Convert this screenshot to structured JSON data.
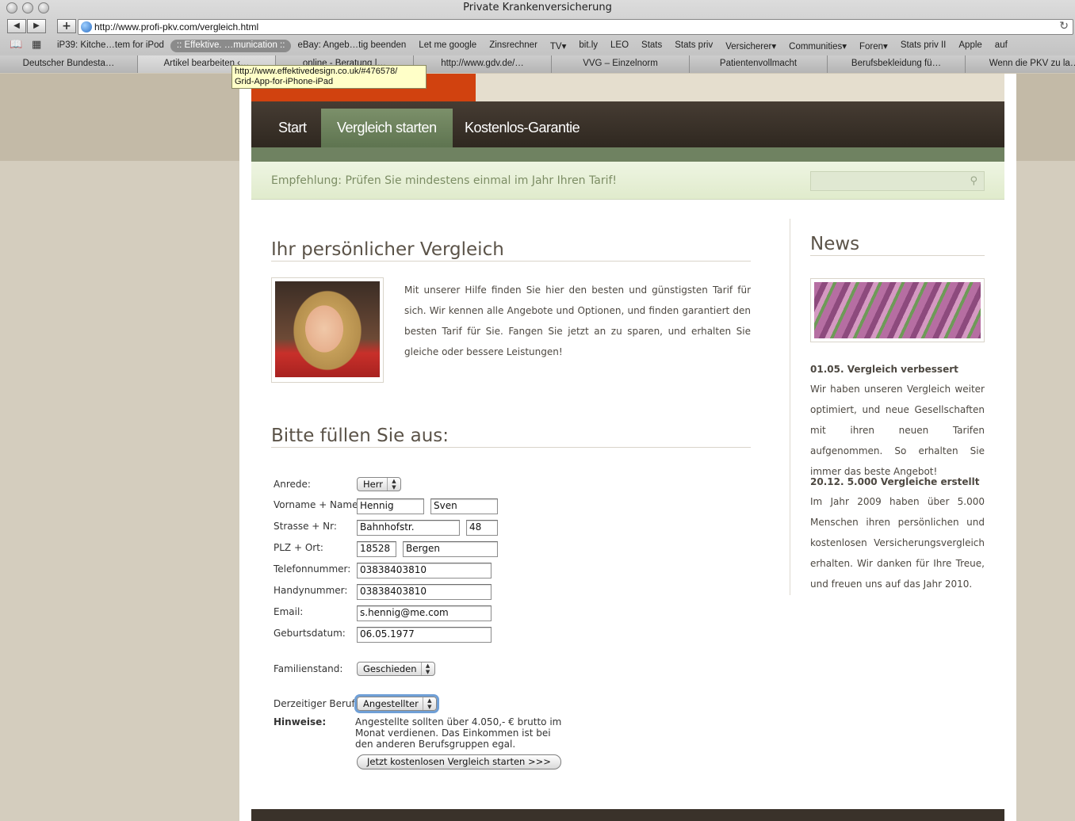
{
  "window": {
    "title": "Private Krankenversicherung"
  },
  "toolbar": {
    "back": "◀",
    "forward": "▶",
    "add": "+",
    "url": "http://www.profi-pkv.com/vergleich.html",
    "reload": "↻"
  },
  "bookmarks": {
    "items": [
      "iP39: Kitche…tem for iPod",
      ":: Effektive. …munication ::",
      "eBay: Angeb…tig beenden",
      "Let me google",
      "Zinsrechner",
      "TV▾",
      "bit.ly",
      "LEO",
      "Stats",
      "Stats priv",
      "Versicherer▾",
      "Communities▾",
      "Foren▾",
      "Stats priv II",
      "Apple",
      "auf"
    ]
  },
  "tabs": [
    "Deutscher Bundesta…",
    "Artikel bearbeiten ‹…",
    "online - Beratung |…",
    "http://www.gdv.de/…",
    "VVG – Einzelnorm",
    "Patientenvollmacht",
    "Berufsbekleidung fü…",
    "Wenn die PKV zu la…"
  ],
  "tooltip": {
    "line1": "http://www.effektivedesign.co.uk/#476578/",
    "line2": "Grid-App-for-iPhone-iPad"
  },
  "nav": {
    "start": "Start",
    "vergleich": "Vergleich starten",
    "garantie": "Kostenlos-Garantie"
  },
  "tipbar": {
    "text": "Empfehlung: Prüfen Sie mindestens einmal im Jahr Ihren Tarif!",
    "search_icon": "⚲"
  },
  "main": {
    "title": "Ihr persönlicher Vergleich",
    "intro": "Mit unserer Hilfe finden Sie hier den besten und günstigsten Tarif für sich. Wir kennen alle Angebote und Optionen, und finden garantiert den besten Tarif für Sie. Fangen Sie jetzt an zu sparen, und erhalten Sie gleiche oder bessere Leistungen!",
    "form_title": "Bitte füllen Sie aus:"
  },
  "form": {
    "anrede": {
      "label": "Anrede:",
      "value": "Herr"
    },
    "name": {
      "label": "Vorname + Name:",
      "first": "Hennig",
      "last": "Sven"
    },
    "strasse": {
      "label": "Strasse + Nr:",
      "street": "Bahnhofstr.",
      "number": "48"
    },
    "plz": {
      "label": "PLZ + Ort:",
      "zip": "18528",
      "city": "Bergen"
    },
    "telefon": {
      "label": "Telefonnummer:",
      "value": "03838403810"
    },
    "handy": {
      "label": "Handynummer:",
      "value": "03838403810"
    },
    "email": {
      "label": "Email:",
      "value": "s.hennig@me.com"
    },
    "geburtsdatum": {
      "label": "Geburtsdatum:",
      "value": "06.05.1977"
    },
    "familienstand": {
      "label": "Familienstand:",
      "value": "Geschieden"
    },
    "beruf": {
      "label": "Derzeitiger Beruf:",
      "value": "Angestellter"
    },
    "hinweise": {
      "label": "Hinweise:",
      "text": "Angestellte sollten über 4.050,- € brutto im Monat verdienen. Das Einkommen ist bei den anderen Berufsgruppen egal."
    },
    "submit": "Jetzt kostenlosen Vergleich starten >>>"
  },
  "news": {
    "title": "News",
    "items": [
      {
        "head": "01.05. Vergleich verbessert",
        "body": "Wir haben unseren Vergleich weiter optimiert, und neue Gesellschaften mit ihren neuen Tarifen aufgenommen. So erhalten Sie immer das beste Angebot!"
      },
      {
        "head": "20.12. 5.000 Vergleiche erstellt",
        "body": "Im Jahr 2009 haben über 5.000 Menschen ihren persönlichen und kostenlosen Versicherungsvergleich erhalten. Wir danken für Ihre Treue, und freuen uns auf das Jahr 2010."
      }
    ]
  },
  "colors": {
    "accent_orange": "#d1420f",
    "nav_dark": "#3a322a",
    "nav_active": "#6f8261",
    "tip_text": "#7c8d64"
  }
}
